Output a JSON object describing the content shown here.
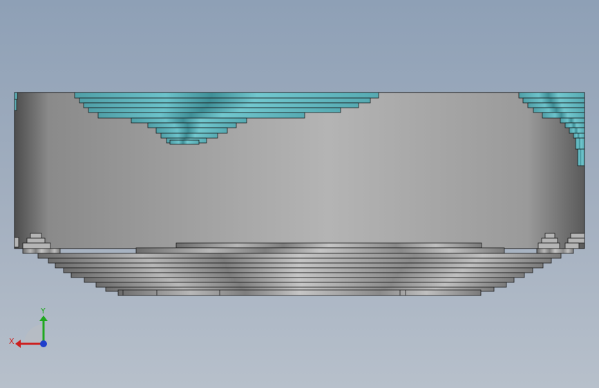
{
  "viewport": {
    "background_top": "#8ea0b6",
    "background_bottom": "#b7c0cb"
  },
  "model": {
    "name": "",
    "body_color_edge": "#5c5c5c",
    "body_color_center": "#b2b2b2",
    "teal_face_color": "#5fb5bd",
    "edge_color": "#1a1a1a"
  },
  "triad": {
    "x_label": "X",
    "y_label": "Y",
    "x_color": "#cc1f1f",
    "y_color": "#1fa81f",
    "z_color": "#1f3fcc"
  }
}
